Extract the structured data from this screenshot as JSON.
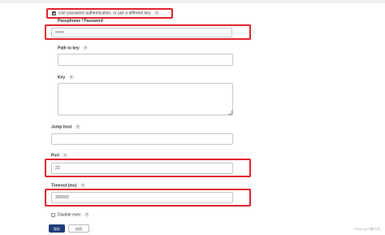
{
  "auth_option": {
    "label": "Use password authentication, or use a different key",
    "checked": true,
    "help": "?"
  },
  "passphrase": {
    "label": "Passphrase / Password",
    "value": "••••••"
  },
  "path_to_key": {
    "label": "Path to key",
    "help": "?",
    "value": ""
  },
  "key": {
    "label": "Key",
    "help": "?",
    "value": ""
  },
  "jump_host": {
    "label": "Jump host",
    "help": "?",
    "value": ""
  },
  "port": {
    "label": "Port",
    "help": "?",
    "value": "22"
  },
  "timeout": {
    "label": "Timeout (ms)",
    "help": "?",
    "value": "300000"
  },
  "disable_exec": {
    "label": "Disable exec",
    "help": "?",
    "checked": false
  },
  "buttons": {
    "save": "保存",
    "apply": "应用"
  },
  "watermark": "CSDN @小鹏方向",
  "colors": {
    "highlight": "#e0242f",
    "primary_button": "#1f3d7a"
  }
}
